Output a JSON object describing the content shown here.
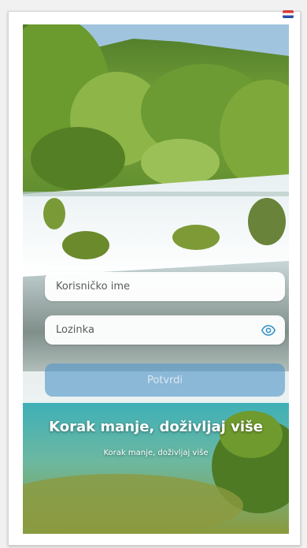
{
  "login": {
    "username_placeholder": "Korisničko ime",
    "password_placeholder": "Lozinka",
    "submit_label": "Potvrdi"
  },
  "tagline": {
    "title": "Korak manje, doživljaj više",
    "subtitle": "Korak manje, doživljaj više"
  },
  "icons": {
    "password_toggle": "eye-icon",
    "language": "flag-icon"
  },
  "colors": {
    "button": "#5096c8",
    "eye_icon": "#2f8fc8",
    "field_bg": "#ffffff"
  }
}
